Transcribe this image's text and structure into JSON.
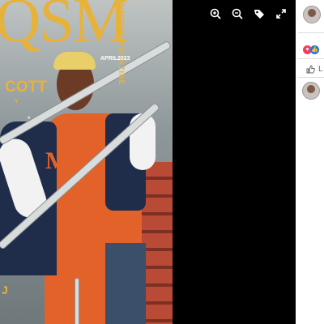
{
  "cover": {
    "masthead": "QSM",
    "side_text": "QUEENS MAGAZINE",
    "date": "APRIL2023",
    "name_fragment": "COTT",
    "sub_fragment": "Y",
    "tag_fragment": "e",
    "bottom_letter": "J",
    "jacket_letter": "M"
  },
  "viewer": {
    "zoom_in_icon": "zoom-in-icon",
    "zoom_out_icon": "zoom-out-icon",
    "tag_icon": "tag-icon",
    "fullscreen_icon": "fullscreen-icon"
  },
  "side_panel": {
    "like_label": "L"
  },
  "colors": {
    "brand_gold": "#e7b23a",
    "jacket_navy": "#1f2d4b",
    "dress_orange": "#e2622a",
    "like_blue": "#1877f2",
    "love_red": "#f33e58"
  }
}
